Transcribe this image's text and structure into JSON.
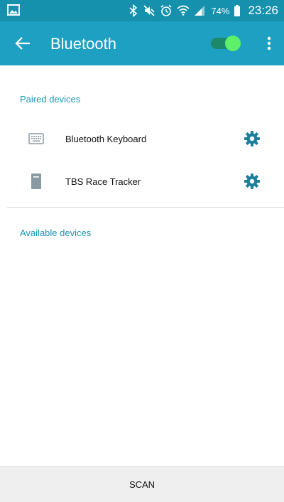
{
  "status_bar": {
    "battery": "74%",
    "time": "23:26",
    "icons": [
      "gallery-icon",
      "bluetooth-icon",
      "mute-icon",
      "alarm-icon",
      "wifi-icon",
      "signal-icon",
      "battery-icon"
    ]
  },
  "app_bar": {
    "title": "Bluetooth",
    "toggle_on": true,
    "back_icon": "arrow-left-icon",
    "menu_icon": "more-vert-icon"
  },
  "paired": {
    "header": "Paired devices",
    "devices": [
      {
        "name": "Bluetooth Keyboard",
        "icon": "keyboard-icon"
      },
      {
        "name": "TBS Race Tracker",
        "icon": "device-icon"
      }
    ]
  },
  "available": {
    "header": "Available devices"
  },
  "bottom": {
    "scan_label": "SCAN"
  },
  "colors": {
    "status_bar": "#1590ad",
    "app_bar": "#1ea0c3",
    "accent": "#1e95b8",
    "gear": "#1d7f9c",
    "toggle_thumb": "#5ef06a"
  }
}
